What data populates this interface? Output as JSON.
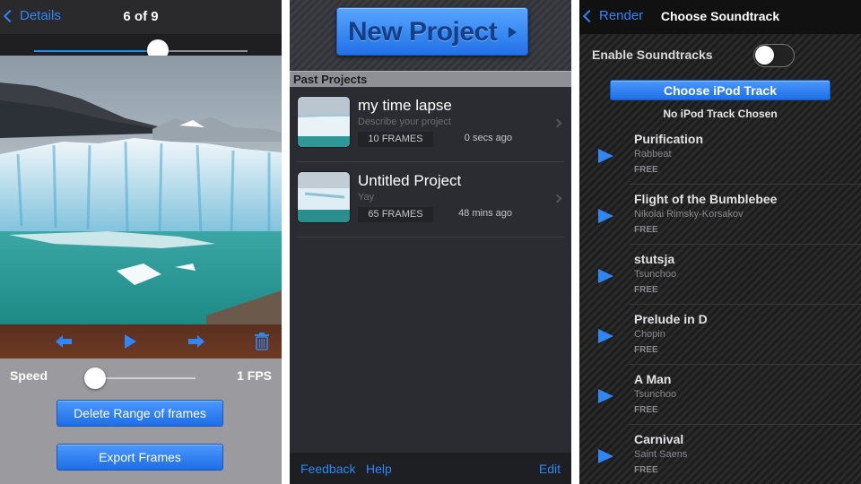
{
  "editor": {
    "back_label": "Details",
    "frame_counter": "6 of 9",
    "frame_position": 0.58,
    "speed_label": "Speed",
    "speed_value": "1 FPS",
    "speed_level": 0.05,
    "delete_range_label": "Delete Range of frames",
    "export_label": "Export Frames",
    "controls": [
      "previous-frame",
      "play",
      "next-frame",
      "trash"
    ]
  },
  "projects": {
    "new_project_label": "New Project",
    "section_title": "Past Projects",
    "items": [
      {
        "title": "my time lapse",
        "description": "Describe your project",
        "frames": "10 FRAMES",
        "time": "0 secs ago"
      },
      {
        "title": "Untitled Project",
        "description": "Yay",
        "frames": "65 FRAMES",
        "time": "48 mins ago"
      }
    ],
    "footer": {
      "feedback": "Feedback",
      "help": "Help",
      "edit": "Edit"
    }
  },
  "soundtrack": {
    "back_label": "Render",
    "title": "Choose Soundtrack",
    "enable_label": "Enable Soundtracks",
    "enabled": false,
    "ipod_button_label": "Choose iPod Track",
    "ipod_status": "No iPod Track Chosen",
    "tracks": [
      {
        "name": "Purification",
        "artist": "Rabbeat",
        "price": "FREE"
      },
      {
        "name": "Flight of the Bumblebee",
        "artist": "Nikolai Rimsky-Korsakov",
        "price": "FREE"
      },
      {
        "name": "stutsja",
        "artist": "Tsunchoo",
        "price": "FREE"
      },
      {
        "name": "Prelude in D",
        "artist": "Chopin",
        "price": "FREE"
      },
      {
        "name": "A Man",
        "artist": "Tsunchoo",
        "price": "FREE"
      },
      {
        "name": "Carnival",
        "artist": "Saint Saens",
        "price": "FREE"
      }
    ]
  },
  "colors": {
    "accent": "#2f86f5",
    "button_blue": "#1e6ee6",
    "dark_bar": "#2a2a2c"
  }
}
